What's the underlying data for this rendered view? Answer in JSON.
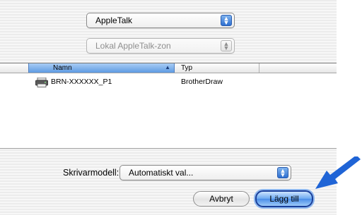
{
  "dialog": {
    "connection_popup": {
      "value": "AppleTalk"
    },
    "zone_popup": {
      "value": "Lokal AppleTalk-zon",
      "enabled": false
    },
    "printer_list": {
      "columns": [
        {
          "label": "Namn",
          "sorted": true
        },
        {
          "label": "Typ"
        }
      ],
      "rows": [
        {
          "icon": "printer-icon",
          "name": "BRN-XXXXXX_P1",
          "type": "BrotherDraw"
        }
      ]
    },
    "model": {
      "label": "Skrivarmodell:",
      "value": "Automatiskt val..."
    },
    "buttons": {
      "cancel": "Avbryt",
      "add": "Lägg till"
    }
  },
  "colors": {
    "accent_blue": "#1E6FD9",
    "pointer_arrow": "#1F64D6"
  },
  "icons": {
    "popup_arrows": "updown-arrows-icon",
    "sort": "sort-ascending-icon",
    "pointer": "arrow-pointer-icon"
  }
}
